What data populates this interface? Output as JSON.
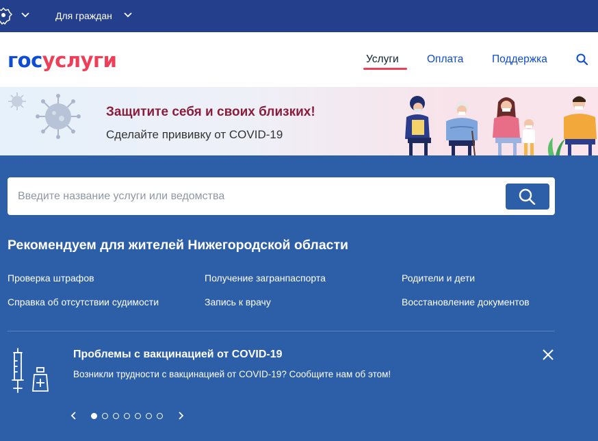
{
  "topbar": {
    "region_label": "Для граждан"
  },
  "header": {
    "logo_part1": "гос",
    "logo_part2": "услуги",
    "nav": [
      {
        "label": "Услуги",
        "active": true
      },
      {
        "label": "Оплата",
        "active": false
      },
      {
        "label": "Поддержка",
        "active": false
      }
    ]
  },
  "banner": {
    "title": "Защитите себя и своих близких!",
    "subtitle": "Сделайте прививку от COVID-19"
  },
  "search": {
    "placeholder": "Введите название услуги или ведомства",
    "value": ""
  },
  "recommendations": {
    "title": "Рекомендуем для жителей Нижегородской области",
    "links": [
      "Проверка штрафов",
      "Получение загранпаспорта",
      "Родители и дети",
      "Справка об отсутствии судимости",
      "Запись к врачу",
      "Восстановление документов"
    ]
  },
  "covid_notice": {
    "title": "Проблемы с вакцинацией от COVID-19",
    "text": "Возникли трудности с вакцинацией от COVID-19? Сообщите нам об этом!"
  },
  "pager": {
    "total": 7,
    "current": 1
  },
  "colors": {
    "topbar": "#243f8c",
    "main_bg": "#2d5fa9",
    "brand_blue": "#0d4cd3",
    "brand_red": "#ee3f58",
    "banner_title": "#8a1d3a"
  },
  "icons": [
    "emblem-icon",
    "chevron-down-icon",
    "search-icon",
    "virus-icon",
    "syringe-icon",
    "vial-icon",
    "close-icon",
    "chevron-left-icon",
    "chevron-right-icon"
  ]
}
